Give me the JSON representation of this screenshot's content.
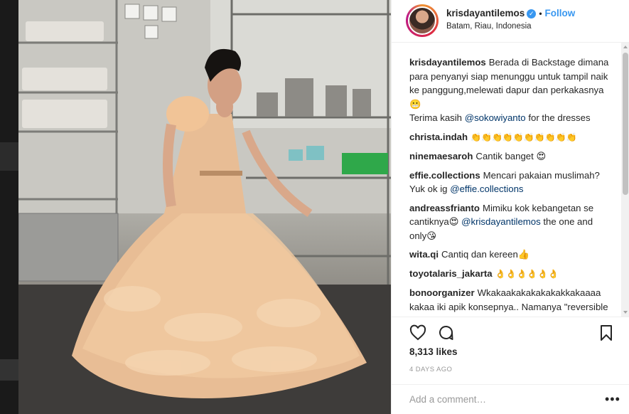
{
  "post": {
    "username": "krisdayantilemos",
    "verified_icon": "verified-badge-icon",
    "separator": "•",
    "follow_label": "Follow",
    "location": "Batam, Riau, Indonesia"
  },
  "comments": [
    {
      "user": "krisdayantilemos",
      "text": "Berada di Backstage dimana para penyanyi siap menunggu untuk tampil naik ke panggung,melewati dapur dan perkakasnya 😬",
      "line2_prefix": "Terima kasih ",
      "mention": "@sokowiyanto",
      "line2_suffix": " for the dresses"
    },
    {
      "user": "christa.indah",
      "text": "👏👏👏👏👏👏👏👏👏👏"
    },
    {
      "user": "ninemaesaroh",
      "text": "Cantik banget 😍"
    },
    {
      "user": "effie.collections",
      "text": "Mencari pakaian muslimah? Yuk ok ig ",
      "mention": "@effie.collections"
    },
    {
      "user": "andreassfrianto",
      "text": "Mimiku kok kebangetan se cantiknya😍 ",
      "mention": "@krisdayantilemos",
      "suffix": " the one and only😘"
    },
    {
      "user": "wita.qi",
      "text": "Cantiq dan kereen👍"
    },
    {
      "user": "toyotalaris_jakarta",
      "text": "👌👌👌👌👌👌"
    },
    {
      "user": "bonoorganizer",
      "text": "Wkakaakakakakakakkakaaaa kakaa iki apik konsepnya.. Namanya \"reversible flow\"..dua dunia yang ada di satu jiwa ya bu \"diva panggung dan diva rumah"
    }
  ],
  "actions": {
    "like_icon": "heart-icon",
    "comment_icon": "comment-icon",
    "save_icon": "bookmark-icon"
  },
  "likes": "8,313 likes",
  "time_ago": "4 DAYS AGO",
  "add_comment": {
    "placeholder": "Add a comment…",
    "more_label": "•••"
  },
  "colors": {
    "link_blue": "#3897f0",
    "mention_blue": "#003569",
    "text": "#262626",
    "muted": "#999999"
  }
}
